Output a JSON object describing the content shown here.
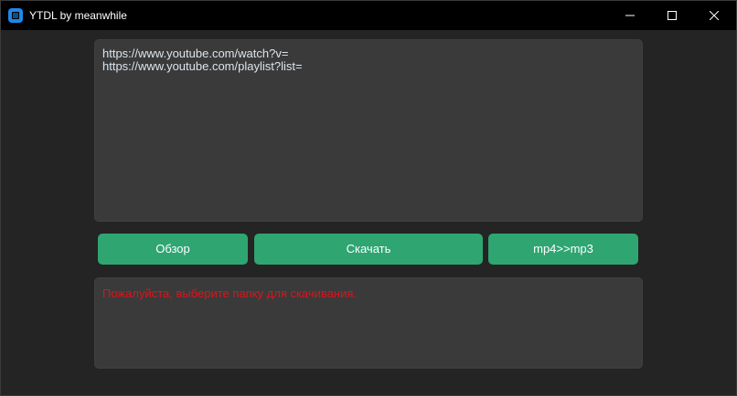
{
  "window": {
    "title": "YTDL by meanwhile",
    "controls": {
      "minimize_icon": "minimize-icon",
      "maximize_icon": "maximize-icon",
      "close_icon": "close-icon"
    }
  },
  "url_input": {
    "value": "https://www.youtube.com/watch?v=\nhttps://www.youtube.com/playlist?list="
  },
  "buttons": {
    "browse_label": "Обзор",
    "download_label": "Скачать",
    "convert_label": "mp4>>mp3"
  },
  "log": {
    "message": "Пожалуйста, выберите папку для скачивания."
  },
  "colors": {
    "accent": "#2fa572",
    "error_text": "#e0121a",
    "window_bg": "#242424",
    "textbox_bg": "#3a3a3a",
    "titlebar_bg": "#000000"
  }
}
